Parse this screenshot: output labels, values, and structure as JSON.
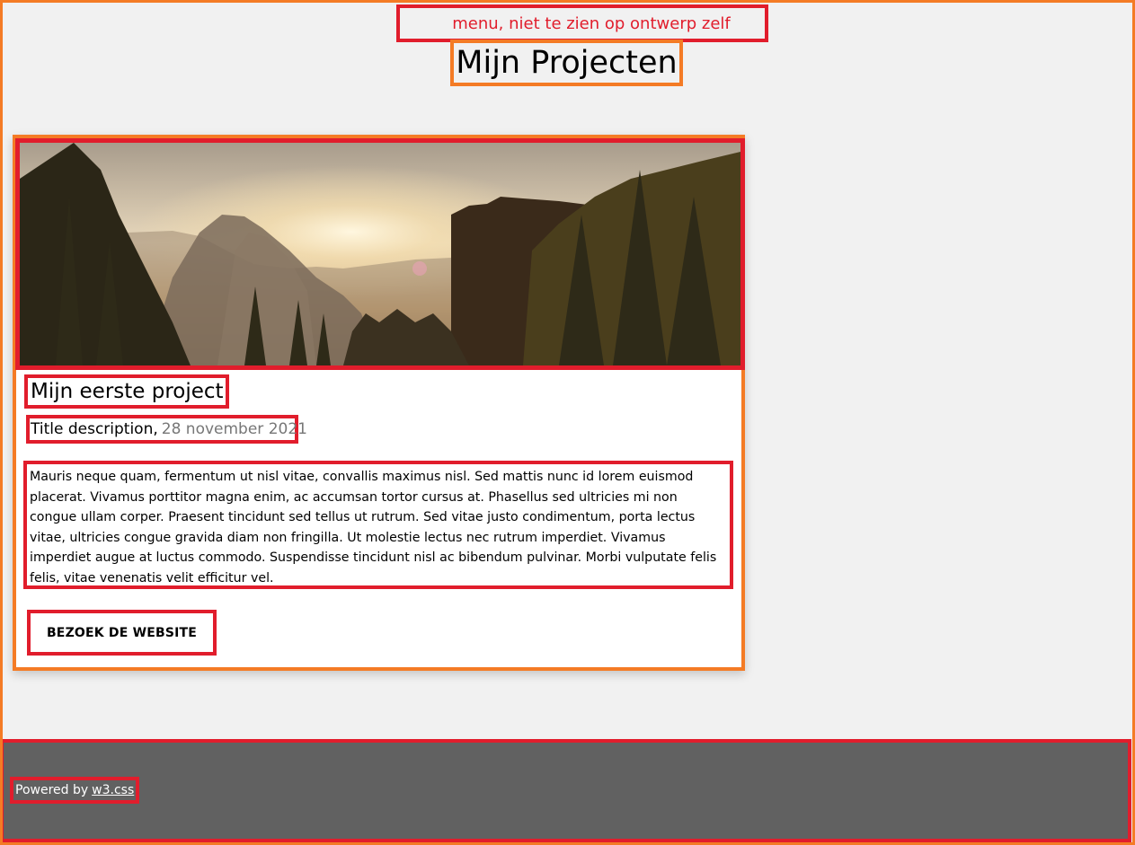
{
  "header": {
    "menu_placeholder": "menu, niet te zien op ontwerp zelf",
    "page_title": "Mijn Projecten"
  },
  "project_card": {
    "title": "Mijn eerste project",
    "description_label": "Title description,",
    "date": "28 november 2021",
    "body": "Mauris neque quam, fermentum ut nisl vitae, convallis maximus nisl. Sed mattis nunc id lorem euismod placerat. Vivamus porttitor magna enim, ac accumsan tortor cursus at. Phasellus sed ultricies mi non congue ullam corper. Praesent tincidunt sed tellus ut rutrum. Sed vitae justo condimentum, porta lectus vitae, ultricies congue gravida diam non fringilla. Ut molestie lectus nec rutrum imperdiet. Vivamus imperdiet augue at luctus commodo. Suspendisse tincidunt nisl ac bibendum pulvinar. Morbi vulputate felis felis, vitae venenatis velit efficitur vel.",
    "button_label": "BEZOEK DE WEBSITE"
  },
  "footer": {
    "powered_by": "Powered by",
    "link_text": "w3.css"
  },
  "colors": {
    "page_background": "#f1f1f1",
    "outline_orange": "#f47b25",
    "outline_red": "#e11d2c",
    "footer_background": "#616161"
  }
}
